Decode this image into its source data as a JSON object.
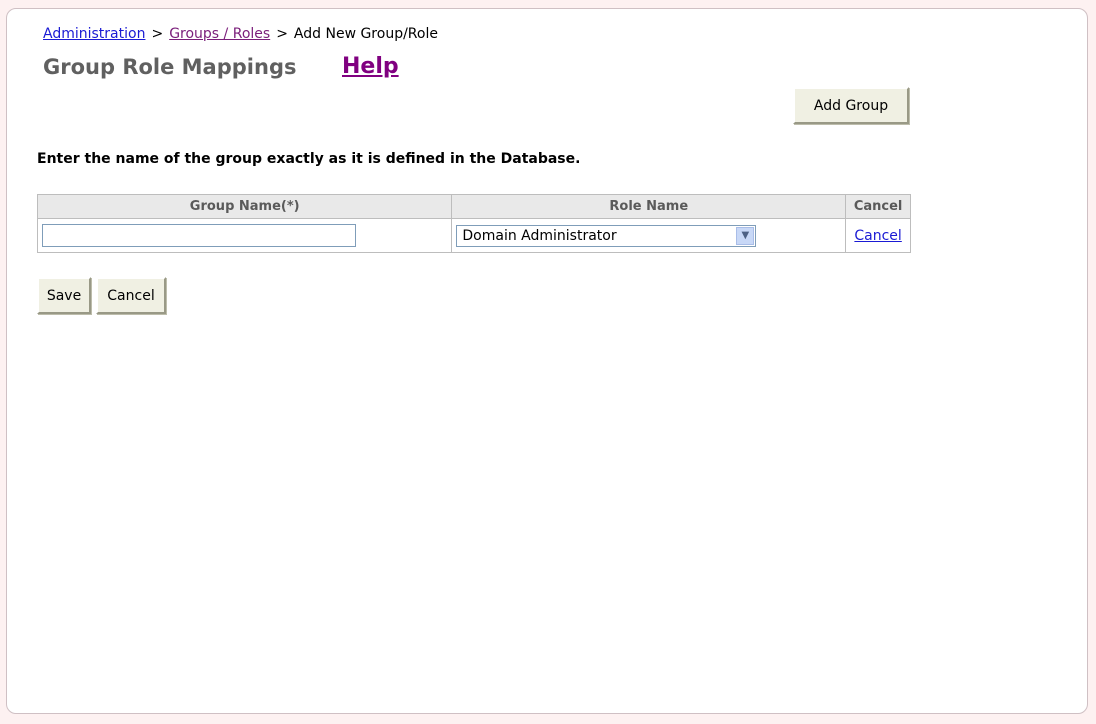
{
  "breadcrumb": {
    "administration": "Administration",
    "separator": ">",
    "groups_roles": "Groups / Roles",
    "current": "Add New Group/Role"
  },
  "page": {
    "title": "Group Role Mappings",
    "help": "Help"
  },
  "buttons": {
    "add_group": "Add Group",
    "save": "Save",
    "cancel": "Cancel"
  },
  "instruction": "Enter the name of the group exactly as it is defined in the Database.",
  "table": {
    "headers": [
      "Group Name(*)",
      "Role Name",
      "Cancel"
    ],
    "rows": [
      {
        "group_name": "",
        "role_name": "Domain Administrator",
        "cancel_link": "Cancel"
      }
    ]
  },
  "icons": {
    "dropdown_arrow": "chevron-down-icon"
  },
  "colors": {
    "link": "#1a1ad4",
    "visited": "#7a1e7a",
    "help": "#800080",
    "button_bg": "#f0f0e3"
  }
}
